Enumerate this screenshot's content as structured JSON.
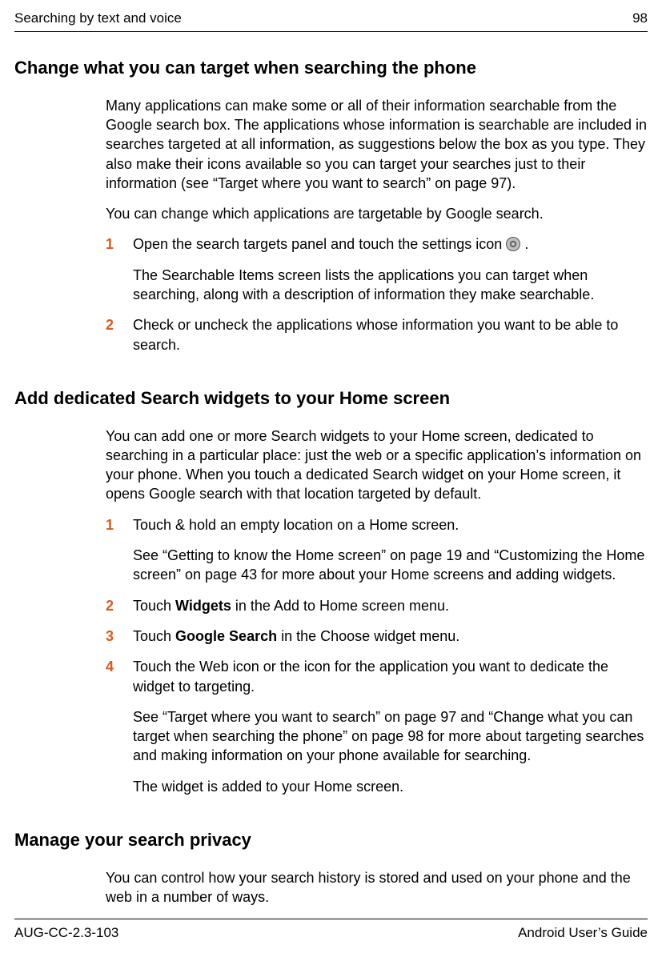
{
  "header": {
    "left": "Searching by text and voice",
    "right": "98"
  },
  "sec1": {
    "heading": "Change what you can target when searching the phone",
    "p1": "Many applications can make some or all of their information searchable from the Google search box. The applications whose information is searchable are included in searches targeted at all information, as suggestions below the box as you type. They also make their icons available so you can target your searches just to their information (see “Target where you want to search” on page 97).",
    "p2": "You can change which applications are targetable by Google search.",
    "step1_num": "1",
    "step1_a": "Open the search targets panel and touch the settings icon ",
    "step1_b": " .",
    "step1_p2": "The Searchable Items screen lists the applications you can target when searching, along with a description of information they make searchable.",
    "step2_num": "2",
    "step2_a": "Check or uncheck the applications whose information you want to be able to search."
  },
  "sec2": {
    "heading": "Add dedicated Search widgets to your Home screen",
    "p1": "You can add one or more Search widgets to your Home screen, dedicated to searching in a particular place: just the web or a specific application’s information on your phone. When you touch a dedicated Search widget on your Home screen, it opens Google search with that location targeted by default.",
    "step1_num": "1",
    "step1_a": "Touch & hold an empty location on a Home screen.",
    "step1_p2": "See “Getting to know the Home screen” on page 19 and “Customizing the Home screen” on page 43 for more about your Home screens and adding widgets.",
    "step2_num": "2",
    "step2_pre": "Touch ",
    "step2_bold": "Widgets",
    "step2_post": " in the Add to Home screen menu.",
    "step3_num": "3",
    "step3_pre": "Touch ",
    "step3_bold": "Google Search",
    "step3_post": " in the Choose widget menu.",
    "step4_num": "4",
    "step4_a": "Touch the Web icon or the icon for the application you want to dedicate the widget to targeting.",
    "step4_p2": "See “Target where you want to search” on page 97 and “Change what you can target when searching the phone” on page 98 for more about targeting searches and making information on your phone available for searching.",
    "step4_p3": "The widget is added to your Home screen."
  },
  "sec3": {
    "heading": "Manage your search privacy",
    "p1": "You can control how your search history is stored and used on your phone and the web in a number of ways."
  },
  "footer": {
    "left": "AUG-CC-2.3-103",
    "right": "Android User’s Guide"
  }
}
